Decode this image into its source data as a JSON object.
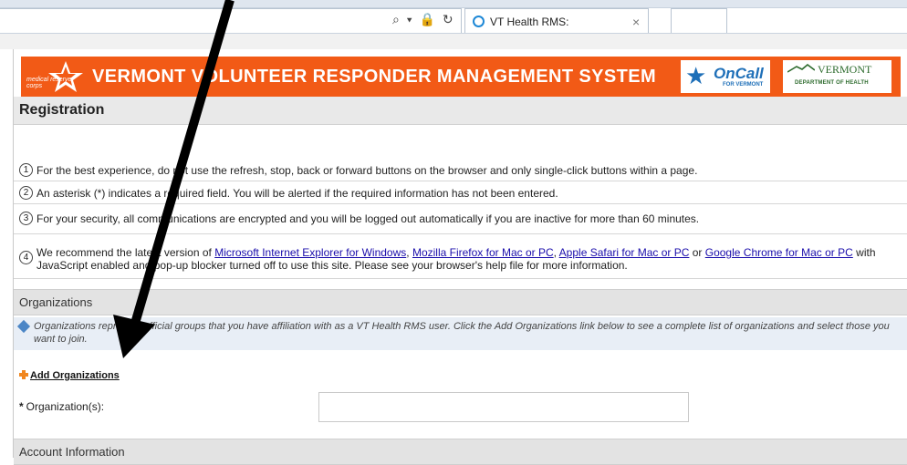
{
  "browser": {
    "tab_title": "VT Health RMS:",
    "tab_close": "×",
    "address_controls": "⌕ ▾ 🔒 ↻"
  },
  "banner": {
    "mrc_text": "medical reserve corps",
    "title": "VERMONT VOLUNTEER RESPONDER MANAGEMENT SYSTEM",
    "oncall_text": "OnCall",
    "oncall_sub": "FOR VERMONT",
    "vt_name": "VERMONT",
    "vt_dept": "DEPARTMENT OF HEALTH"
  },
  "page": {
    "title": "Registration"
  },
  "notices": {
    "n1": {
      "num": "1",
      "text": "For the best experience, do not use the refresh, stop, back or forward buttons on the browser and only single-click buttons within a page."
    },
    "n2": {
      "num": "2",
      "text": "An asterisk (*) indicates a required field. You will be alerted if the required information has not been entered."
    },
    "n3": {
      "num": "3",
      "text": "For your security, all communications are encrypted and you will be logged out automatically if you are inactive for more than 60 minutes."
    },
    "n4": {
      "num": "4",
      "text_before": "We recommend the latest version of ",
      "link_ie": "Microsoft Internet Explorer for Windows",
      "sep1": ", ",
      "link_firefox": "Mozilla Firefox for Mac or PC",
      "sep2": ", ",
      "link_safari": "Apple Safari for Mac or PC",
      "sep3": " or ",
      "link_chrome": "Google Chrome for Mac or PC",
      "text_after": " with JavaScript enabled and pop-up blocker turned off to use this site. Please see your browser's help file for more information."
    }
  },
  "organizations": {
    "section_title": "Organizations",
    "help_text": "Organizations represent official groups that you have affiliation with as a VT Health RMS user. Click the Add Organizations link below to see a complete list of organizations and select those you want to join.",
    "add_link": "Add Organizations",
    "field_asterisk": "*",
    "field_label": "Organization(s):",
    "field_value": ""
  },
  "account": {
    "section_title": "Account Information"
  },
  "colors": {
    "banner": "#f25a16",
    "link": "#1a0dab",
    "section_bg": "#e3e3e3",
    "help_bg": "#e8eef6"
  }
}
